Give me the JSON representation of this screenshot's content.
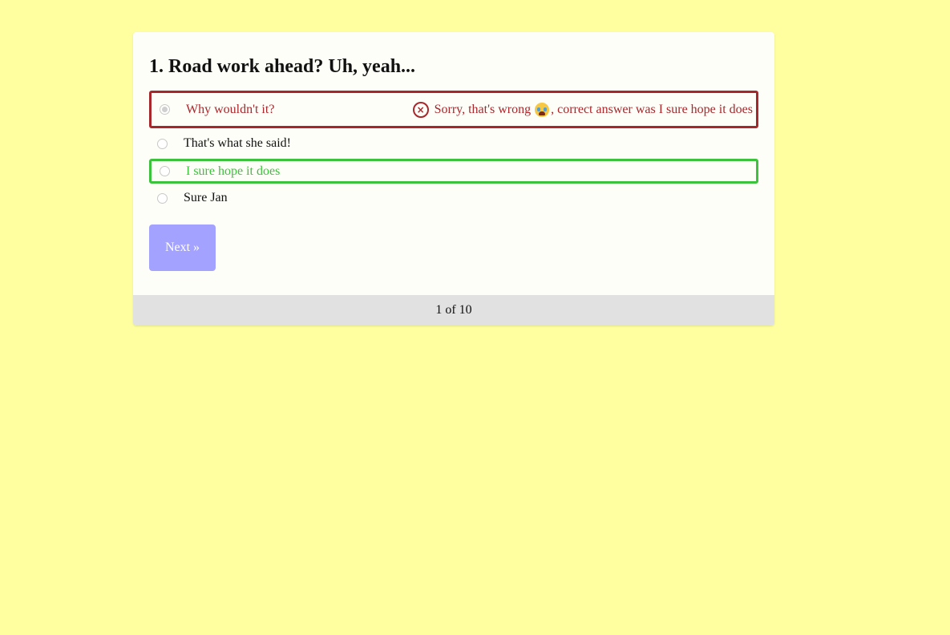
{
  "quiz": {
    "question_title": "1. Road work ahead? Uh, yeah...",
    "options": [
      {
        "label": "Why wouldn't it?",
        "state": "selected-wrong"
      },
      {
        "label": "That's what she said!",
        "state": "unselected"
      },
      {
        "label": "I sure hope it does",
        "state": "correct"
      },
      {
        "label": "Sure Jan",
        "state": "unselected"
      }
    ],
    "feedback": {
      "prefix": "Sorry, that's wrong",
      "suffix": ", correct answer was I sure hope it does",
      "icon": "close-circle-icon",
      "emoji": "crying-face-icon"
    },
    "next_label": "Next »",
    "progress": "1 of 10"
  },
  "colors": {
    "background": "#ffffa0",
    "wrong": "#a8272c",
    "correct": "#3cc23c",
    "button": "#a3a3ff",
    "footer": "#e1e1e1"
  }
}
